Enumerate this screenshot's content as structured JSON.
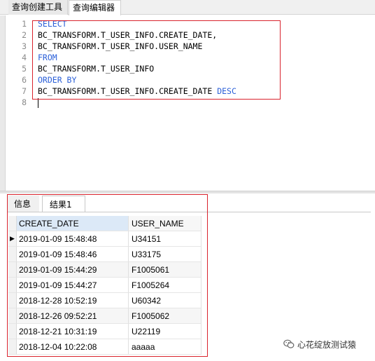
{
  "top_tabs": [
    "查询创建工具",
    "查询编辑器"
  ],
  "editor": {
    "line_numbers": [
      "1",
      "2",
      "3",
      "4",
      "5",
      "6",
      "7",
      "8"
    ],
    "lines": [
      {
        "kw": "SELECT",
        "text": ""
      },
      {
        "kw": "",
        "text": "BC_TRANSFORM.T_USER_INFO.CREATE_DATE,"
      },
      {
        "kw": "",
        "text": "BC_TRANSFORM.T_USER_INFO.USER_NAME"
      },
      {
        "kw": "FROM",
        "text": ""
      },
      {
        "kw": "",
        "text": "BC_TRANSFORM.T_USER_INFO"
      },
      {
        "kw": "ORDER BY",
        "text": ""
      },
      {
        "kw": "",
        "text": "BC_TRANSFORM.T_USER_INFO.CREATE_DATE ",
        "trail_kw": "DESC"
      },
      {
        "kw": "",
        "text": ""
      }
    ]
  },
  "result_tabs": [
    "信息",
    "结果1"
  ],
  "grid": {
    "columns": [
      "CREATE_DATE",
      "USER_NAME"
    ],
    "rows": [
      [
        "2019-01-09 15:48:48",
        "U34151"
      ],
      [
        "2019-01-09 15:48:46",
        "U33175"
      ],
      [
        "2019-01-09 15:44:29",
        "F1005061"
      ],
      [
        "2019-01-09 15:44:27",
        "F1005264"
      ],
      [
        "2018-12-28 10:52:19",
        "U60342"
      ],
      [
        "2018-12-26 09:52:21",
        "F1005062"
      ],
      [
        "2018-12-21 10:31:19",
        "U22119"
      ],
      [
        "2018-12-04 10:22:08",
        "aaaaa"
      ]
    ],
    "current_row_marker": "▶"
  },
  "watermark": {
    "text": "心花绽放测试猿",
    "icon": "wechat-icon"
  },
  "colors": {
    "keyword": "#2a5fd8",
    "highlight_box": "#d9232d",
    "header_selected": "#dce9f7"
  }
}
